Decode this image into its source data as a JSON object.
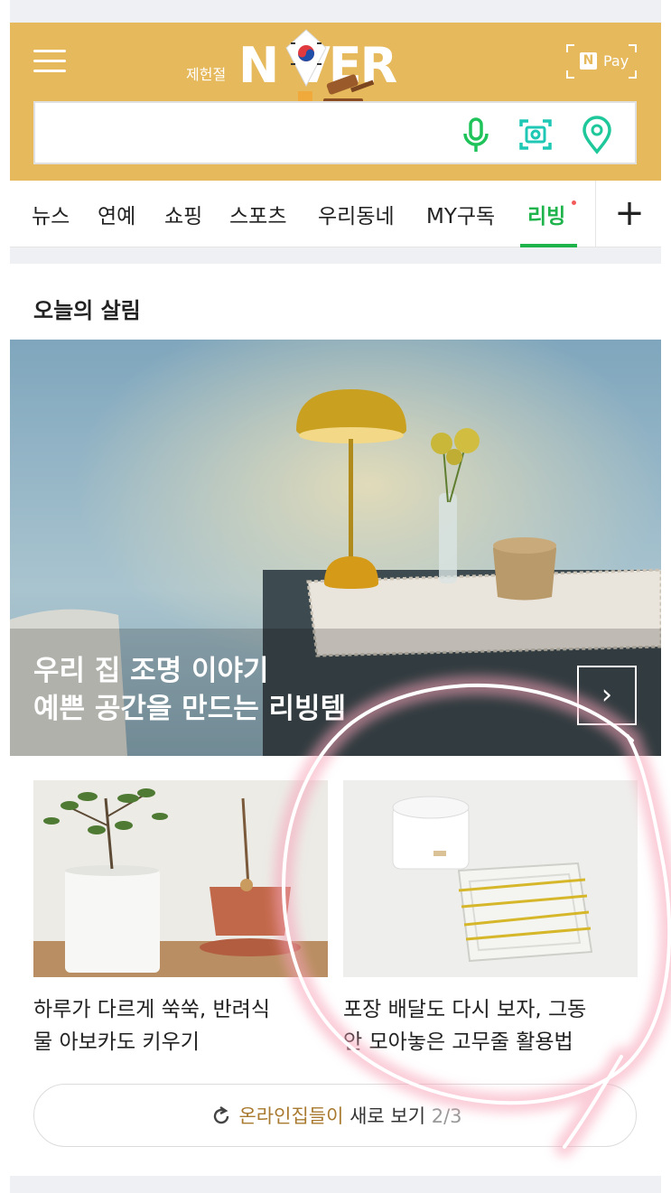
{
  "header": {
    "logo_sub": "제헌절",
    "logo_text": "N  VER",
    "npay_n": "N",
    "npay_label": "Pay",
    "search_placeholder": ""
  },
  "tabs": {
    "items": [
      "뉴스",
      "연예",
      "쇼핑",
      "스포츠",
      "우리동네",
      "MY구독",
      "리빙"
    ],
    "active": "리빙",
    "plus": "+"
  },
  "section": {
    "title": "오늘의 살림"
  },
  "hero": {
    "line1": "우리 집 조명 이야기",
    "line2": "예쁜 공간을 만드는 리빙템",
    "next": "›"
  },
  "articles": [
    {
      "line1": "하루가 다르게 쑥쑥, 반려식",
      "line2": "물 아보카도 키우기"
    },
    {
      "line1": "포장 배달도 다시 보자, 그동",
      "line2": "안 모아놓은 고무줄 활용법"
    }
  ],
  "more": {
    "accent": "온라인집들이",
    "rest": " 새로 보기 ",
    "page": "2/3"
  },
  "colors": {
    "header_bg": "#e6b95c",
    "active_green": "#1fb34c",
    "annotation": "#f06b8a"
  }
}
